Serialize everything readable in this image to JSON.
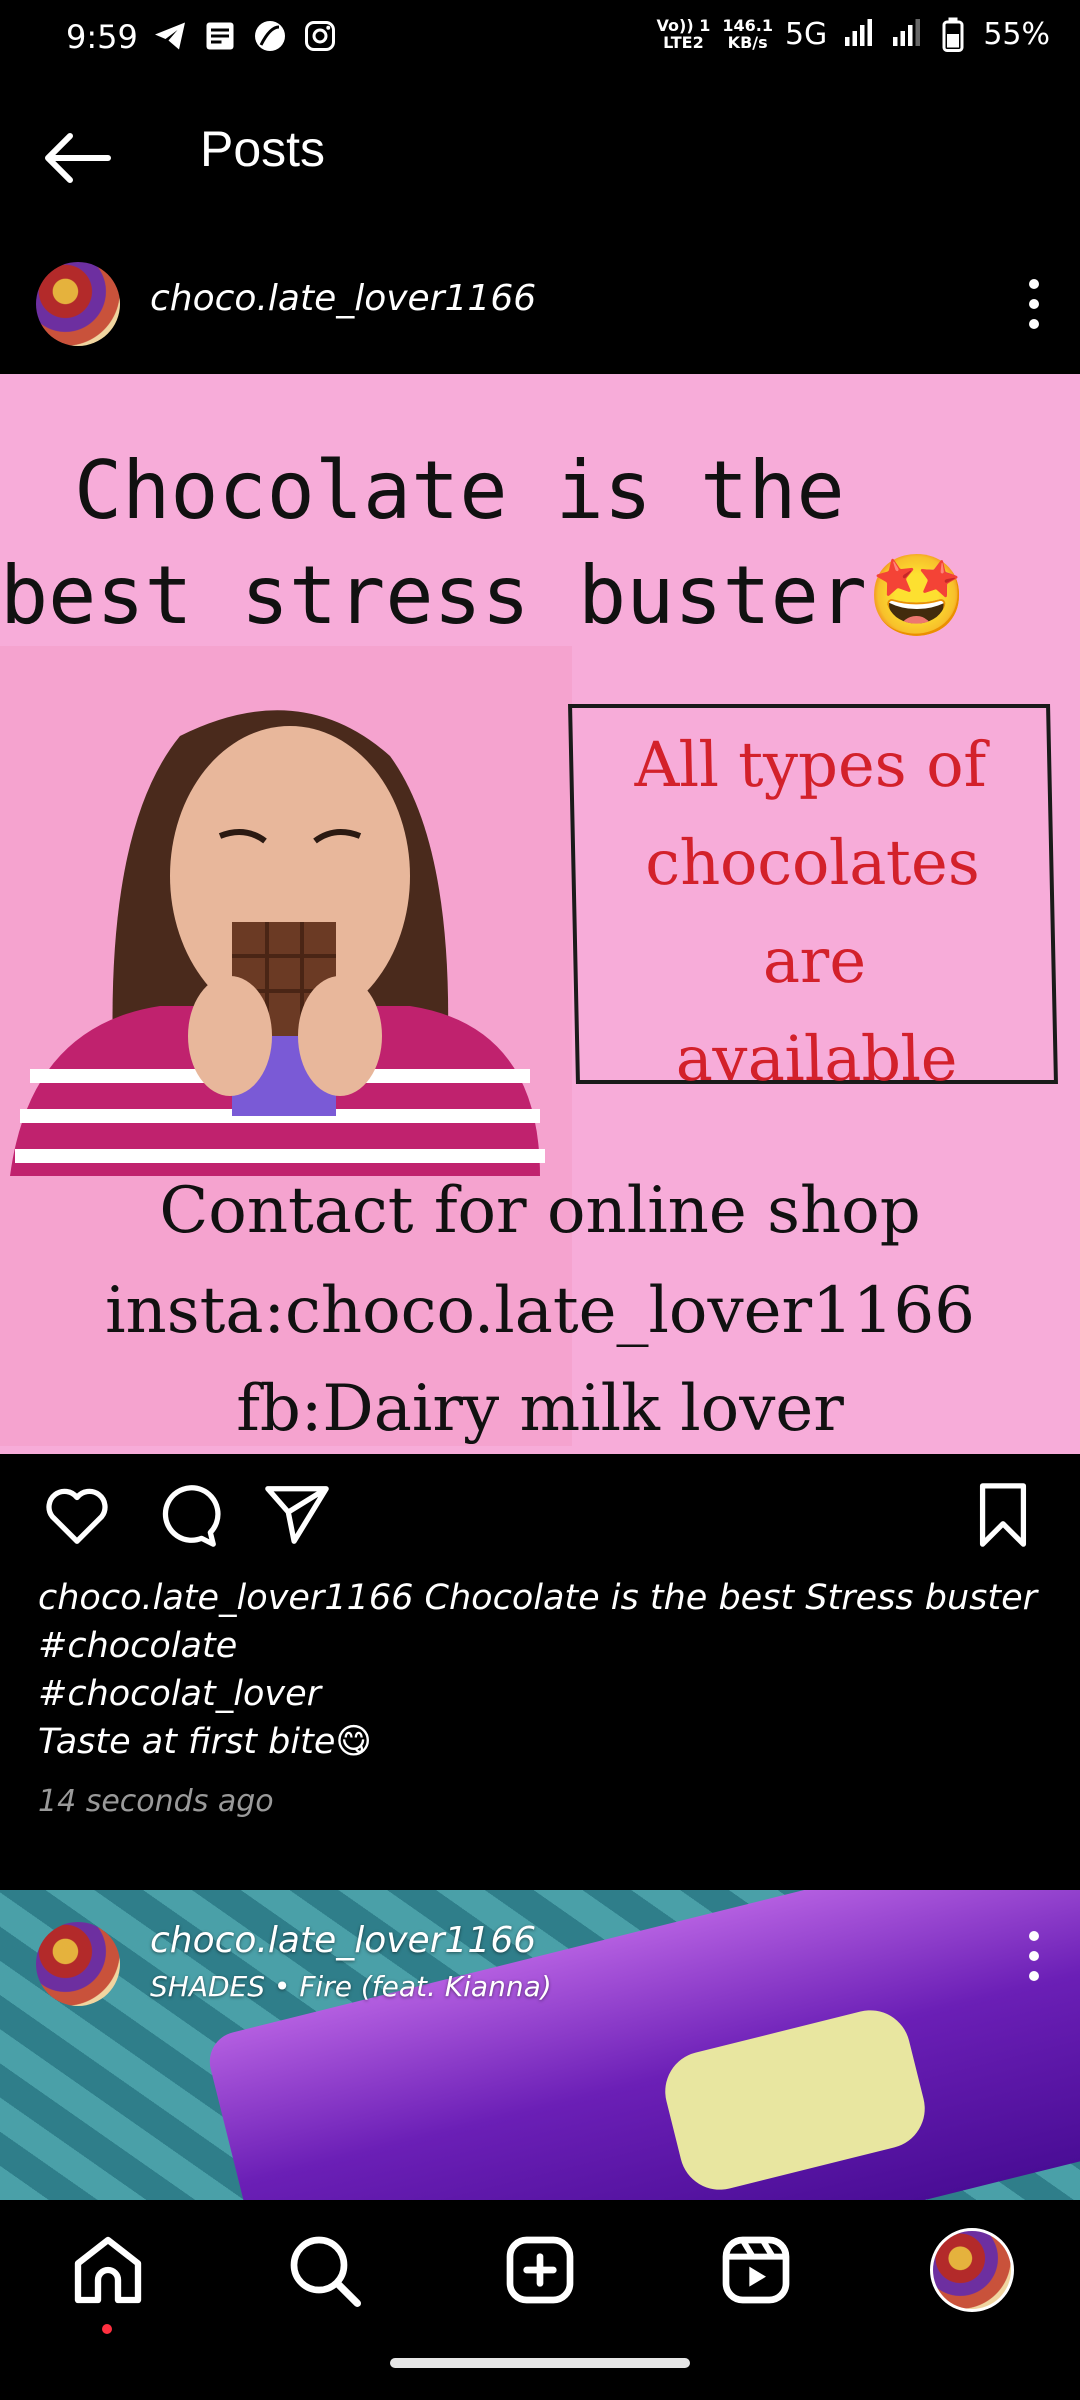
{
  "status_bar": {
    "time": "9:59",
    "left_icons": [
      "telegram-icon",
      "docs-icon",
      "leaf-app-icon",
      "instagram-icon"
    ],
    "volte_line1": "Vo)) 1",
    "volte_line2": "LTE2",
    "speed_value": "146.1",
    "speed_unit": "KB/s",
    "network": "5G",
    "battery": "55%"
  },
  "header": {
    "title": "Posts"
  },
  "post": {
    "username": "choco.late_lover1166",
    "image_text": {
      "title_line1": "Chocolate is the",
      "title_line2": "best stress buster🤩",
      "box_line1": "All types of",
      "box_line2": "chocolates",
      "box_line3": "are",
      "box_line4": "available",
      "contact_line1": "Contact for online shop",
      "contact_line2": "insta:choco.late_lover1166",
      "contact_line3": "fb:Dairy milk lover"
    },
    "caption_user": "choco.late_lover1166",
    "caption_line1": "Chocolate is the best Stress buster",
    "caption_line2": "#chocolate",
    "caption_line3": "#chocolat_lover",
    "caption_line4": "Taste at first bite😋",
    "timestamp": "14 seconds ago"
  },
  "next_post": {
    "username": "choco.late_lover1166",
    "music": "SHADES • Fire (feat. Kianna)"
  },
  "colors": {
    "post_background": "#f7acd9",
    "box_text": "#d3212b",
    "notification_dot": "#ff3040"
  },
  "bottom_nav": [
    "home-icon",
    "search-icon",
    "create-icon",
    "reels-icon",
    "profile-avatar"
  ]
}
